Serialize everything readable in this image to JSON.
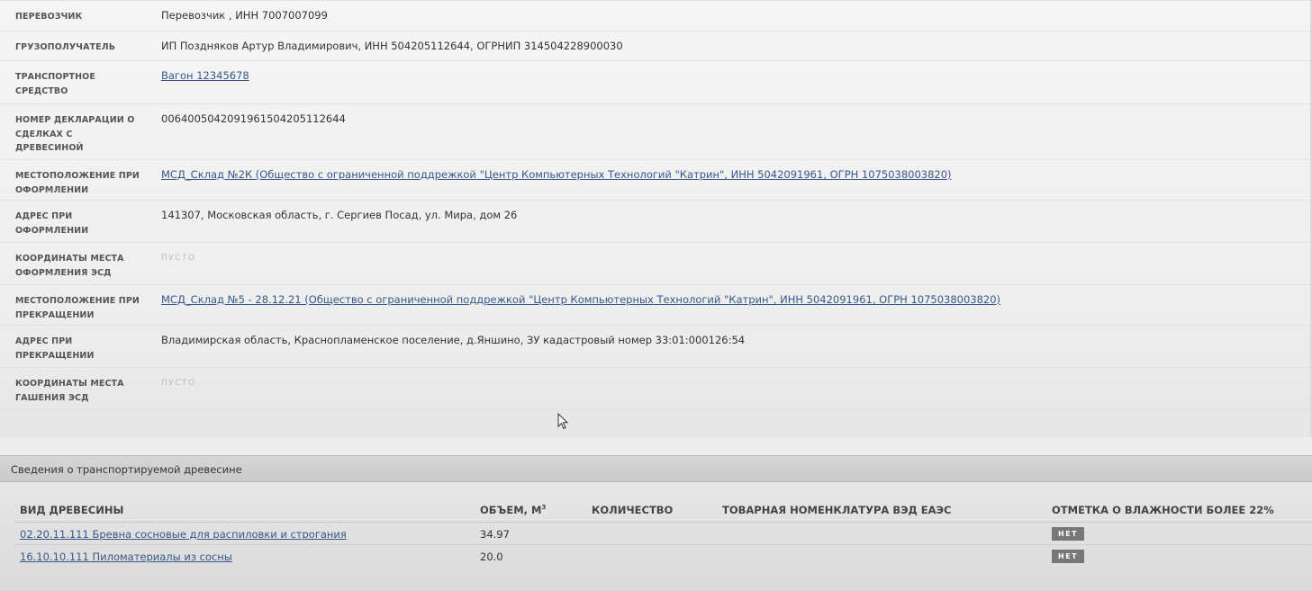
{
  "details": [
    {
      "label": "Перевозчик",
      "value": "Перевозчик , ИНН 7007007099",
      "type": "text"
    },
    {
      "label": "Грузополучатель",
      "value": "ИП Поздняков Артур Владимирович, ИНН 504205112644, ОГРНИП 314504228900030",
      "type": "text"
    },
    {
      "label": "Транспортное средство",
      "value": "Вагон 12345678",
      "type": "link"
    },
    {
      "label": "Номер декларации о сделках с древесиной",
      "value": "0064005042091961504205112644",
      "type": "text"
    },
    {
      "label": "Местоположение при оформлении",
      "value": "МСД_Склад №2К (Общество с ограниченной поддрежкой \"Центр Компьютерных Технологий \"Катрин\", ИНН 5042091961, ОГРН 1075038003820)",
      "type": "link"
    },
    {
      "label": "Адрес при оформлении",
      "value": "141307, Московская область, г. Сергиев Посад, ул. Мира, дом 26",
      "type": "text"
    },
    {
      "label": "Координаты места оформления ЭСД",
      "value": "ПУСТО",
      "type": "empty"
    },
    {
      "label": "Местоположение при прекращении",
      "value": "МСД_Склад №5 - 28.12.21 (Общество с ограниченной поддрежкой \"Центр Компьютерных Технологий \"Катрин\", ИНН 5042091961, ОГРН 1075038003820)",
      "type": "link"
    },
    {
      "label": "Адрес при прекращении",
      "value": "Владимирская область, Краснопламенское поселение, д.Яншино, ЗУ кадастровый номер 33:01:000126:54",
      "type": "text"
    },
    {
      "label": "Координаты места гашения ЭСД",
      "value": "ПУСТО",
      "type": "empty"
    }
  ],
  "wood_section": {
    "title": "Сведения о транспортируемой древесине",
    "headers": {
      "species": "Вид древесины",
      "volume": "Объем, м",
      "volume_sup": "3",
      "quantity": "Количество",
      "nomenclature": "Товарная номенклатура ВЭД ЕАЭС",
      "humidity": "Отметка о влажности более 22%"
    },
    "rows": [
      {
        "species": "02.20.11.111 Бревна сосновые для распиловки и строгания",
        "volume": "34.97",
        "quantity": "",
        "nomenclature": "",
        "humidity": "НЕТ"
      },
      {
        "species": "16.10.10.111 Пиломатериалы из сосны",
        "volume": "20.0",
        "quantity": "",
        "nomenclature": "",
        "humidity": "НЕТ"
      }
    ]
  },
  "colors": {
    "link": "#37588a",
    "badge": "#777777"
  }
}
